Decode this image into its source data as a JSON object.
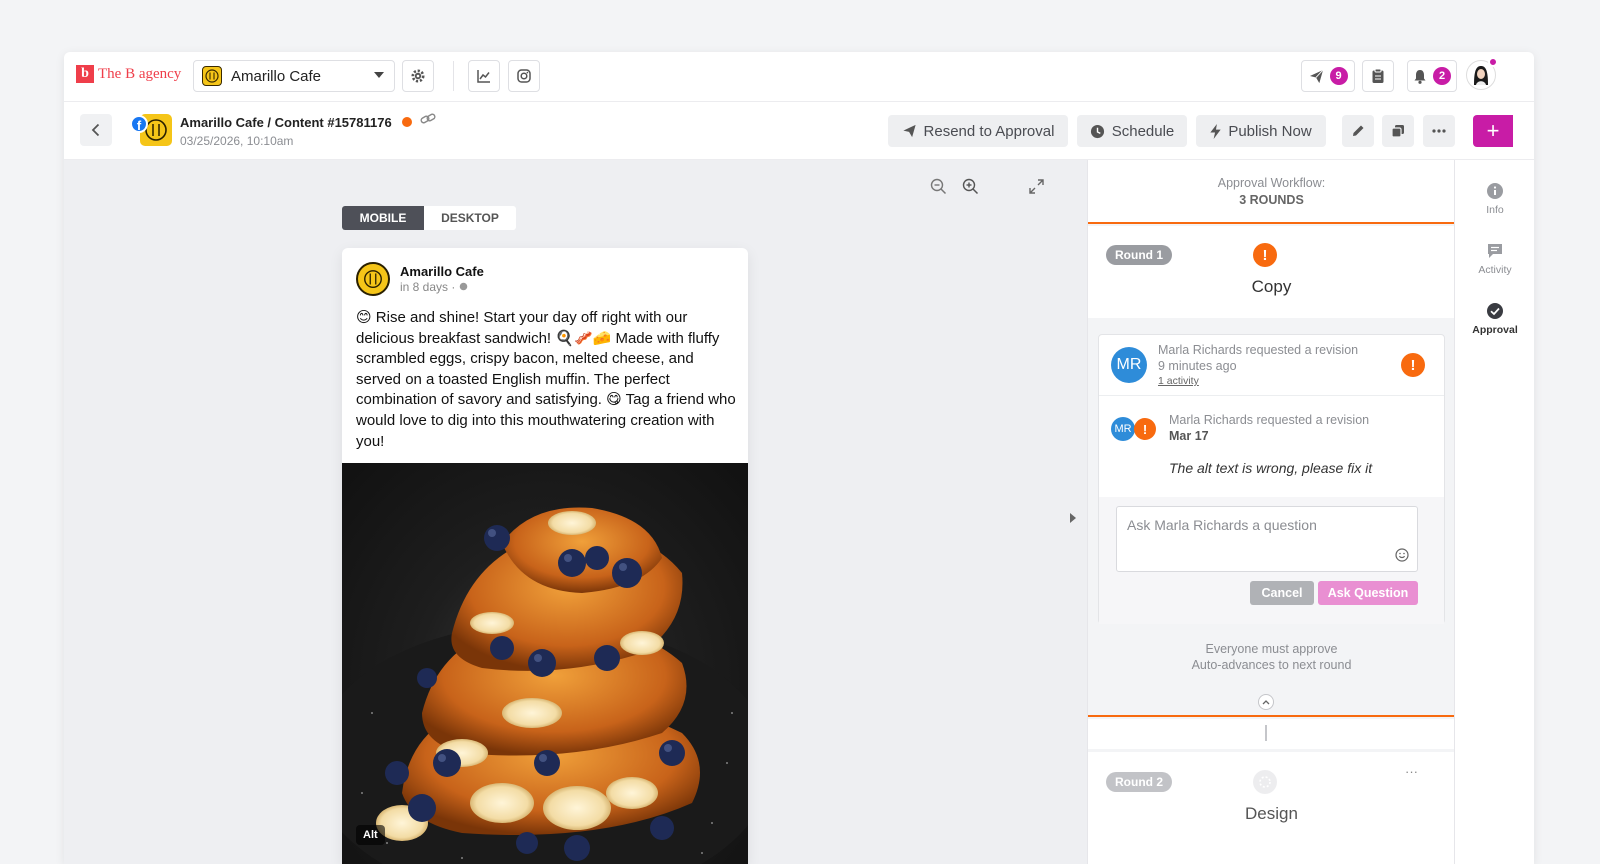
{
  "brand": {
    "logo_letter": "b",
    "logo_text": "The B agency",
    "color": "#ef3e4a"
  },
  "client_select": {
    "value": "Amarillo Cafe"
  },
  "topbar": {
    "send_badge": "9",
    "notif_badge": "2"
  },
  "post_header": {
    "title": "Amarillo Cafe / Content #15781176",
    "date": "03/25/2026, 10:10am",
    "status_color": "#f86a0f"
  },
  "actions": {
    "resend": "Resend to Approval",
    "schedule": "Schedule",
    "publish": "Publish Now",
    "plus": "+"
  },
  "preview": {
    "tabs": {
      "mobile": "MOBILE",
      "desktop": "DESKTOP"
    },
    "post": {
      "page_name": "Amarillo Cafe",
      "time": "in 8 days ·",
      "text": "😊 Rise and shine! Start your day off right with our delicious breakfast sandwich! 🍳🥓🧀 Made with fluffy scrambled eggs, crispy bacon, melted cheese, and served on a toasted English muffin. The perfect combination of savory and satisfying. 😋 Tag a friend who would love to dig into this mouthwatering creation with you!",
      "alt_label": "Alt"
    }
  },
  "approval": {
    "workflow_label": "Approval Workflow:",
    "rounds": "3 ROUNDS",
    "round1": {
      "pill": "Round 1",
      "name": "Copy"
    },
    "revision_card": {
      "initials": "MR",
      "summary": "Marla Richards requested a revision",
      "ago": "9 minutes ago",
      "activity": "1 activity",
      "entry_text": "Marla Richards requested a revision",
      "entry_date": "Mar 17",
      "comment": "The alt text is wrong, please fix it",
      "ask_placeholder": "Ask Marla Richards a question",
      "cancel": "Cancel",
      "ask": "Ask Question"
    },
    "rule_line1": "Everyone must approve",
    "rule_line2": "Auto-advances to next round",
    "round2": {
      "pill": "Round 2",
      "name": "Design",
      "menu": "···"
    }
  },
  "side_tabs": [
    {
      "label": "Info",
      "icon": "info-icon"
    },
    {
      "label": "Activity",
      "icon": "comment-icon"
    },
    {
      "label": "Approval",
      "icon": "check-circle-icon"
    }
  ],
  "colors": {
    "accent": "#c81ca6",
    "warning": "#f86a0f",
    "facebook": "#1877f2"
  }
}
